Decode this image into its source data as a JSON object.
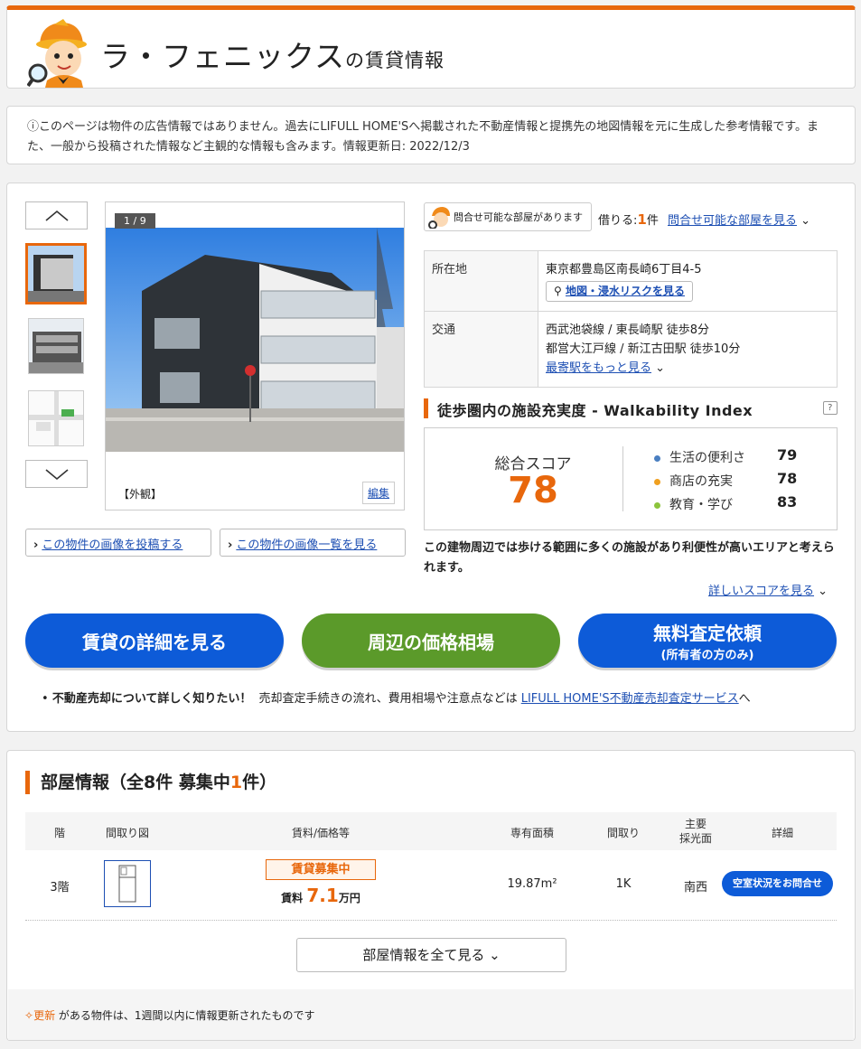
{
  "header": {
    "title": "ラ・フェニックス",
    "title_suffix": "の賃貸情報"
  },
  "notice": {
    "icon": "info-circle-icon",
    "text": "ⓘこのページは物件の広告情報ではありません。過去にLIFULL HOME'Sへ掲載された不動産情報と提携先の地図情報を元に生成した参考情報です。また、一般から投稿された情報など主観的な情報も含みます。情報更新日: 2022/12/3"
  },
  "gallery": {
    "counter": "1 / 9",
    "caption": "【外観】",
    "edit_label": "編集",
    "post_images_link": "この物件の画像を投稿する",
    "view_images_link": "この物件の画像一覧を見る"
  },
  "inquiry": {
    "chip_label": "問合せ可能な部屋があります",
    "rent_prefix": "借りる:",
    "rent_count": "1",
    "rent_suffix": "件",
    "view_link": "問合せ可能な部屋を見る"
  },
  "info": {
    "location_label": "所在地",
    "address": "東京都豊島区南長崎6丁目4-5",
    "map_button": "地図・浸水リスクを見る",
    "transit_label": "交通",
    "station1": "西武池袋線 / 東長崎駅 徒歩8分",
    "station2": "都営大江戸線 / 新江古田駅 徒歩10分",
    "more_stations": "最寄駅をもっと見る"
  },
  "walkability": {
    "heading": "徒歩圏内の施設充実度 - Walkability Index",
    "help": "?",
    "total_label": "総合スコア",
    "total_score": "78",
    "sub_scores": [
      {
        "label": "生活の便利さ",
        "value": "79",
        "color": "#4a7fc1"
      },
      {
        "label": "商店の充実",
        "value": "78",
        "color": "#f0a020"
      },
      {
        "label": "教育・学び",
        "value": "83",
        "color": "#8cc43c"
      }
    ],
    "description": "この建物周辺では歩ける範囲に多くの施設があり利便性が高いエリアと考えられます。",
    "details_link": "詳しいスコアを見る"
  },
  "actions": {
    "rent_details": "賃貸の詳細を見る",
    "price_market": "周辺の価格相場",
    "appraisal_line1": "無料査定依頼",
    "appraisal_line2": "(所有者の方のみ)",
    "colors": {
      "blue": "#0d5bd8",
      "green": "#5b9a2a",
      "accent": "#e8670c"
    }
  },
  "sell_note": {
    "bold": "不動産売却について詳しく知りたい！",
    "text": "売却査定手続きの流れ、費用相場や注意点などは",
    "link": "LIFULL HOME'S不動産売却査定サービス",
    "suffix": "へ"
  },
  "rooms": {
    "title_prefix": "部屋情報（全8件 募集中",
    "title_count": "1",
    "title_suffix": "件）",
    "headers": {
      "floor": "階",
      "plan": "間取り図",
      "price": "賃料/価格等",
      "area": "専有面積",
      "layout": "間取り",
      "light1": "主要",
      "light2": "採光面",
      "detail": "詳細"
    },
    "row": {
      "floor": "3階",
      "badge": "賃貸募集中",
      "rent_label": "賃料",
      "rent_value": "7.1",
      "rent_unit": "万円",
      "area": "19.87m²",
      "layout": "1K",
      "light": "南西",
      "action": "空室状況をお問合せ"
    },
    "view_all": "部屋情報を全て見る",
    "footer_update": "更新",
    "footer_text": "がある物件は、1週間以内に情報更新されたものです"
  }
}
